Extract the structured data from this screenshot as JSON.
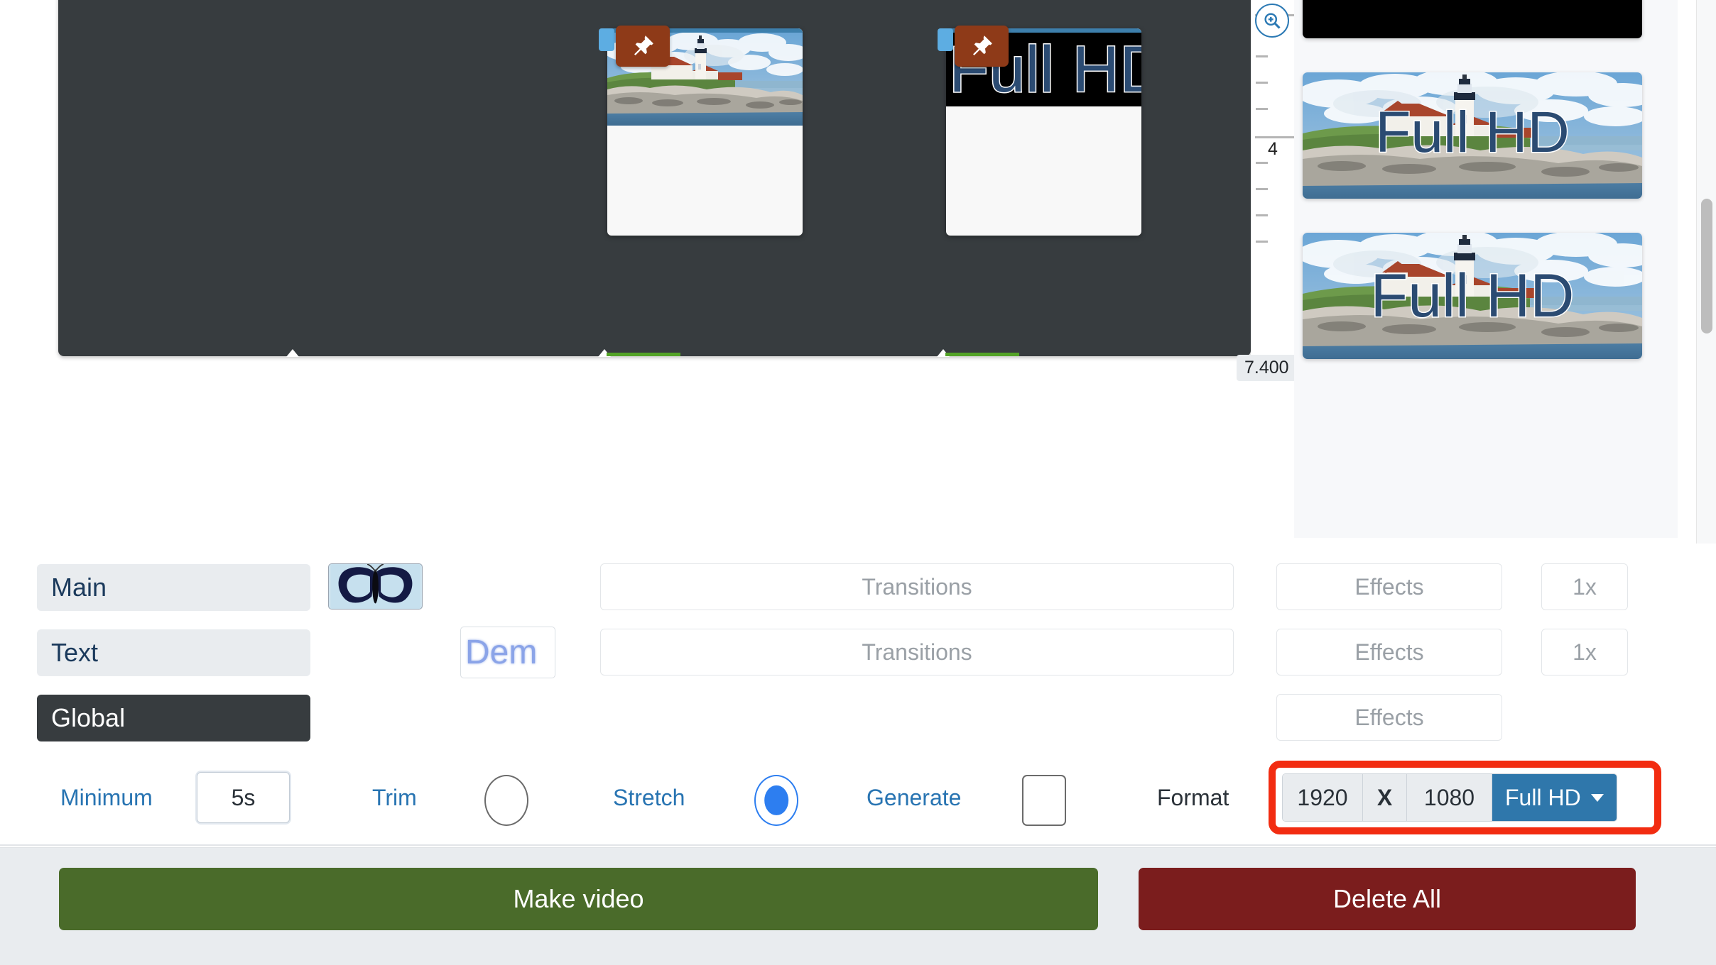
{
  "timeline": {
    "clips": [
      {
        "id": "clip-1",
        "kind": "image",
        "pin_icon": "pin-icon",
        "overlay_text": ""
      },
      {
        "id": "clip-2",
        "kind": "text-on-black",
        "pin_icon": "pin-icon",
        "overlay_text": "Full HD"
      }
    ]
  },
  "ruler": {
    "zoom_icon": "zoom-in-icon",
    "tick_label": "4",
    "end_time": "7.400"
  },
  "preview": {
    "items": [
      {
        "label": "",
        "kind": "black"
      },
      {
        "label": "Full HD",
        "kind": "photo-with-text"
      },
      {
        "label": "Full HD",
        "kind": "photo-with-text"
      }
    ]
  },
  "tracks": [
    {
      "name": "Main",
      "selected": false,
      "thumb": "butterfly-icon",
      "transition_label": "Transitions",
      "effects_label": "Effects",
      "speed_label": "1x"
    },
    {
      "name": "Text",
      "selected": false,
      "thumb": "demo-text-chip",
      "transition_label": "Transitions",
      "effects_label": "Effects",
      "speed_label": "1x"
    },
    {
      "name": "Global",
      "selected": true,
      "thumb": "",
      "transition_label": "",
      "effects_label": "Effects",
      "speed_label": ""
    }
  ],
  "text_chip": {
    "value": "Dem"
  },
  "options": {
    "minimum_label": "Minimum",
    "minimum_value": "5s",
    "trim_label": "Trim",
    "trim_checked": false,
    "stretch_label": "Stretch",
    "stretch_checked": true,
    "generate_label": "Generate",
    "generate_checked": false
  },
  "format": {
    "label": "Format",
    "width": "1920",
    "separator": "X",
    "height": "1080",
    "preset": "Full HD",
    "caret_icon": "chevron-down-icon",
    "highlight_color": "#f22c11",
    "preset_color": "#2f77ab"
  },
  "footer": {
    "make_video_label": "Make video",
    "make_video_color": "#4a6b2a",
    "delete_all_label": "Delete All",
    "delete_all_color": "#7b1d1d"
  }
}
